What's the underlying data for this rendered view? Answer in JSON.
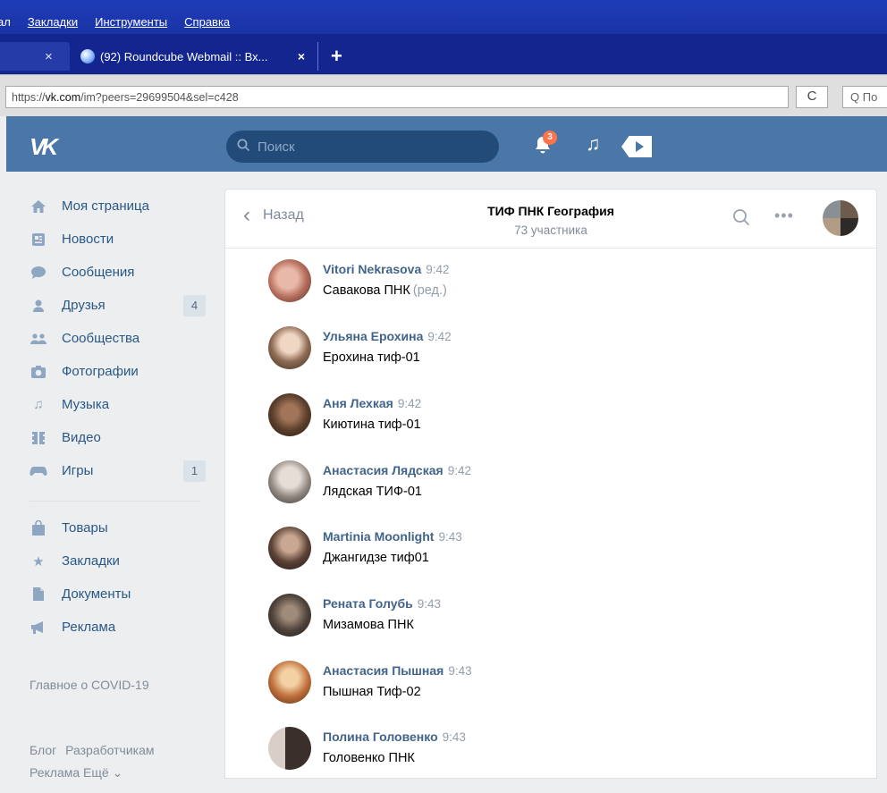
{
  "browser": {
    "menu": [
      "ал",
      "Закладки",
      "Инструменты",
      "Справка"
    ],
    "tabs": [
      {
        "close": "×"
      },
      {
        "title": "(92) Roundcube Webmail :: Вх...",
        "close": "×"
      }
    ],
    "new_tab": "+",
    "url_prefix": "https://",
    "url_domain": "vk.com",
    "url_path": "/im?peers=29699504&sel=c428",
    "reload": "C",
    "find_placeholder": "Q По"
  },
  "vk_header": {
    "logo": "VK",
    "search_placeholder": "Поиск",
    "notifications_count": "3"
  },
  "sidebar": {
    "items": [
      {
        "label": "Моя страница",
        "icon": "home-icon"
      },
      {
        "label": "Новости",
        "icon": "news-icon"
      },
      {
        "label": "Сообщения",
        "icon": "messages-icon"
      },
      {
        "label": "Друзья",
        "icon": "friends-icon",
        "count": "4"
      },
      {
        "label": "Сообщества",
        "icon": "communities-icon"
      },
      {
        "label": "Фотографии",
        "icon": "camera-icon"
      },
      {
        "label": "Музыка",
        "icon": "music-icon"
      },
      {
        "label": "Видео",
        "icon": "video-icon"
      },
      {
        "label": "Игры",
        "icon": "games-icon",
        "count": "1"
      },
      {
        "label": "Товары",
        "icon": "shopping-bag-icon"
      },
      {
        "label": "Закладки",
        "icon": "star-icon"
      },
      {
        "label": "Документы",
        "icon": "document-icon"
      },
      {
        "label": "Реклама",
        "icon": "megaphone-icon"
      }
    ],
    "covid": "Главное о COVID-19",
    "footer_line1": "Блог Разработчикам",
    "footer_line2": "Реклама Ещё ⌄"
  },
  "chat": {
    "back": "Назад",
    "title": "ТИФ ПНК География",
    "subtitle": "73 участника",
    "more": "•••",
    "messages": [
      {
        "name": "Vitori Nekrasova",
        "time": "9:42",
        "text": "Савакова ПНК",
        "edited": "(ред.)"
      },
      {
        "name": "Ульяна Ерохина",
        "time": "9:42",
        "text": "Ерохина тиф-01"
      },
      {
        "name": "Аня Лехкая",
        "time": "9:42",
        "text": "Киютина тиф-01"
      },
      {
        "name": "Анастасия Лядская",
        "time": "9:42",
        "text": "Лядская ТИФ-01"
      },
      {
        "name": "Martinia Moonlight",
        "time": "9:43",
        "text": "Джангидзе тиф01"
      },
      {
        "name": "Рената Голубь",
        "time": "9:43",
        "text": "Мизамова ПНК"
      },
      {
        "name": "Анастасия Пышная",
        "time": "9:43",
        "text": "Пышная Тиф-02"
      },
      {
        "name": "Полина Головенко",
        "time": "9:43",
        "text": "Головенко ПНК"
      }
    ]
  },
  "colors": {
    "vk_blue": "#4a76a8",
    "link": "#2a5885",
    "badge": "#ff734c",
    "browser_blue": "#1a33a6"
  }
}
